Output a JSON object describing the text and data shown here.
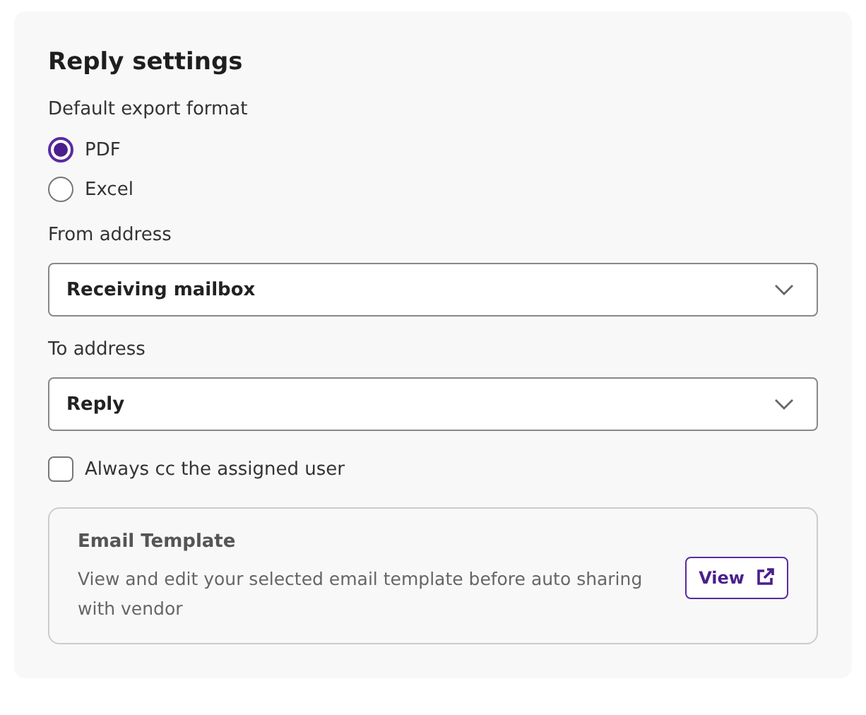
{
  "title": "Reply settings",
  "export_format": {
    "label": "Default export format",
    "options": [
      {
        "label": "PDF",
        "selected": true
      },
      {
        "label": "Excel",
        "selected": false
      }
    ]
  },
  "from_address": {
    "label": "From address",
    "value": "Receiving mailbox"
  },
  "to_address": {
    "label": "To address",
    "value": "Reply"
  },
  "always_cc": {
    "label": "Always cc the assigned user",
    "checked": false
  },
  "email_template": {
    "title": "Email Template",
    "description": "View and edit your selected email template before auto sharing with vendor",
    "button": "View"
  }
}
